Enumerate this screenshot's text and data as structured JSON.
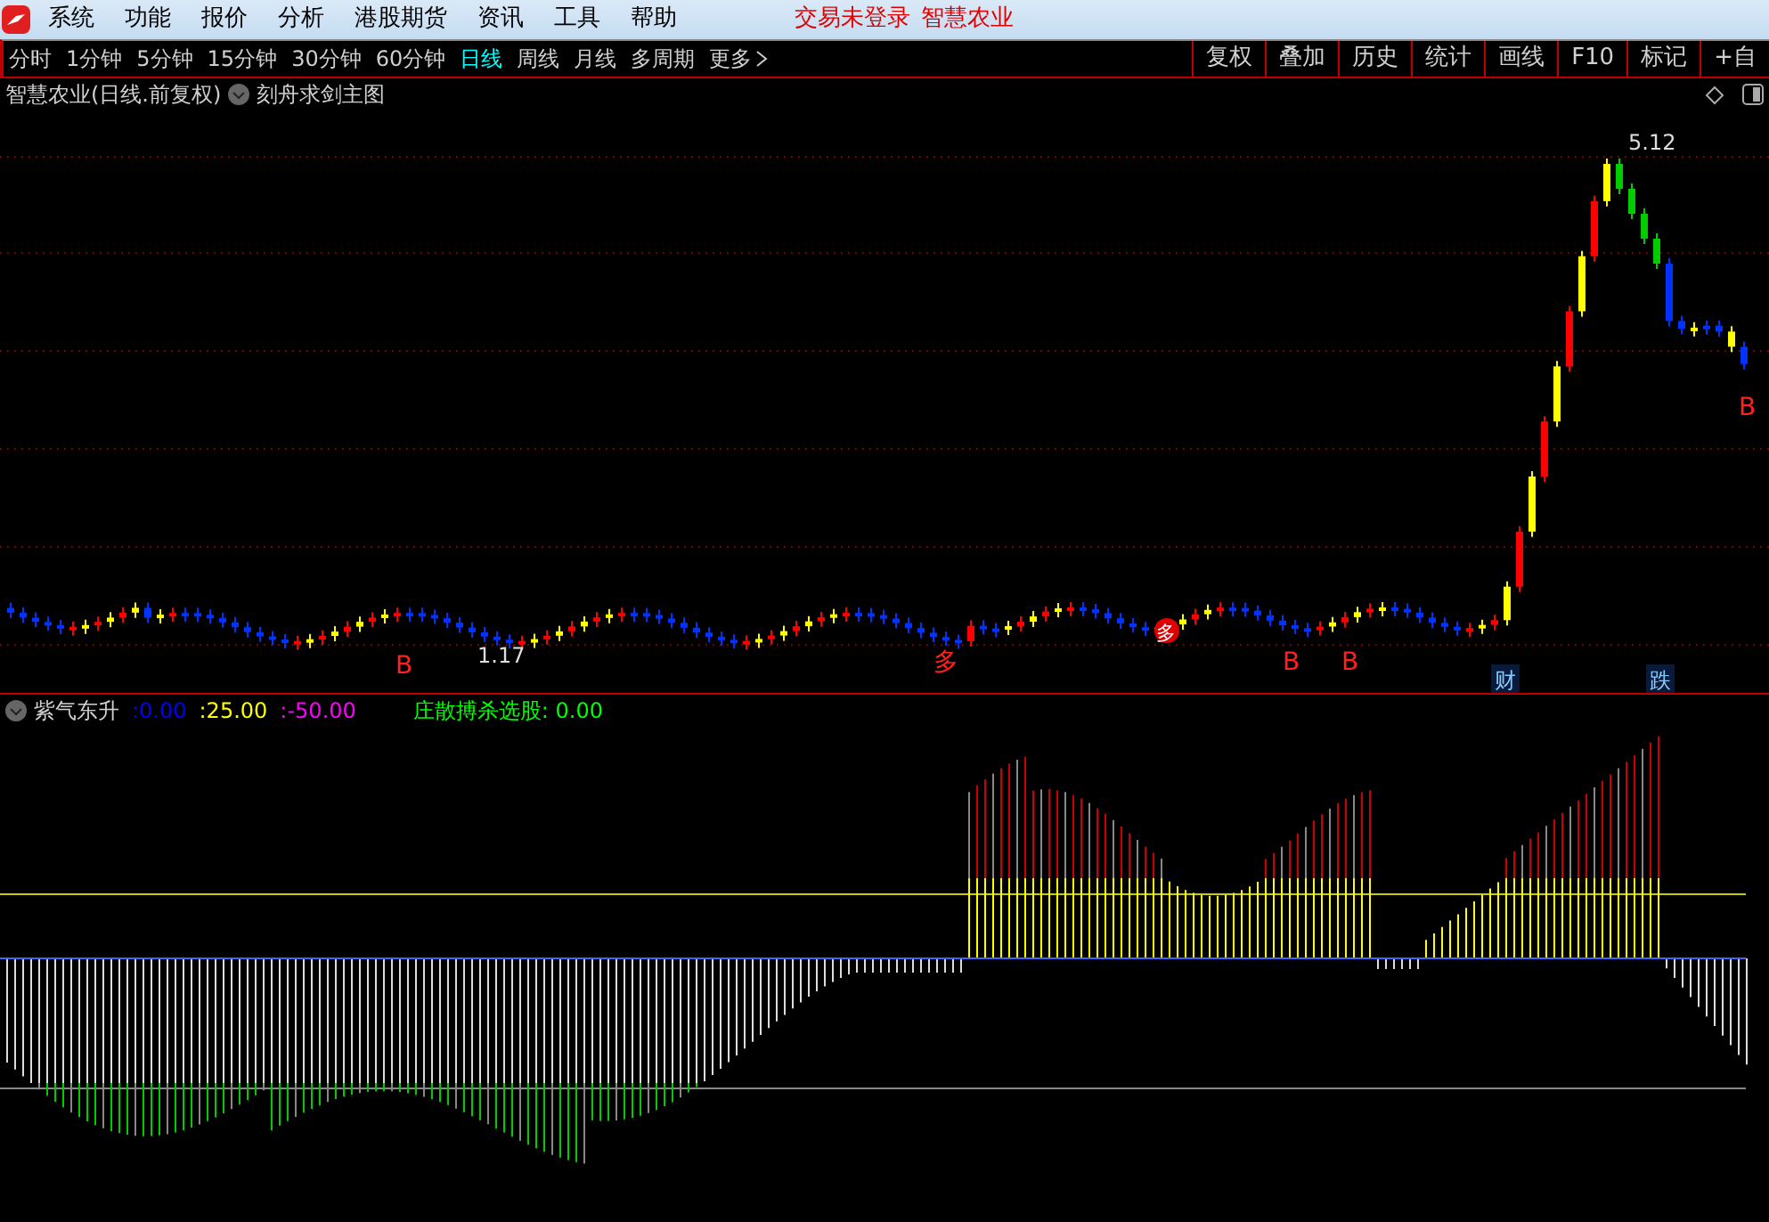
{
  "menu_bar": {
    "items": [
      "系统",
      "功能",
      "报价",
      "分析",
      "港股期货",
      "资讯",
      "工具",
      "帮助"
    ],
    "status_text": "交易未登录",
    "stock_name": "智慧农业"
  },
  "period_tabs": [
    {
      "label": "分时",
      "selected": false
    },
    {
      "label": "1分钟",
      "selected": false
    },
    {
      "label": "5分钟",
      "selected": false
    },
    {
      "label": "15分钟",
      "selected": false
    },
    {
      "label": "30分钟",
      "selected": false
    },
    {
      "label": "60分钟",
      "selected": false
    },
    {
      "label": "日线",
      "selected": true
    },
    {
      "label": "周线",
      "selected": false
    },
    {
      "label": "月线",
      "selected": false
    },
    {
      "label": "多周期",
      "selected": false
    },
    {
      "label": "更多",
      "selected": false
    }
  ],
  "tools": [
    "复权",
    "叠加",
    "历史",
    "统计",
    "画线",
    "F10",
    "标记",
    "+自"
  ],
  "main_chart": {
    "title": "智慧农业(日线.前复权)",
    "indicator": "刻舟求剑主图",
    "labels": [
      {
        "text": "B",
        "kind": "signal"
      },
      {
        "text": "1.17",
        "kind": "price"
      },
      {
        "text": "多",
        "kind": "signal"
      },
      {
        "text": "多",
        "kind": "circle"
      },
      {
        "text": "B",
        "kind": "signal"
      },
      {
        "text": "B",
        "kind": "signal"
      },
      {
        "text": "财",
        "kind": "tag"
      },
      {
        "text": "5.12",
        "kind": "price"
      },
      {
        "text": "跌",
        "kind": "tag"
      },
      {
        "text": "B",
        "kind": "signal"
      }
    ]
  },
  "sub_chart": {
    "name": "紫气东升",
    "values": [
      {
        "text": ":0.00",
        "color": "#0000ff"
      },
      {
        "text": ":25.00",
        "color": "#ffff00"
      },
      {
        "text": ":-50.00",
        "color": "#ff00ff"
      }
    ],
    "signal": "庄散搏杀选股: 0.00"
  }
}
